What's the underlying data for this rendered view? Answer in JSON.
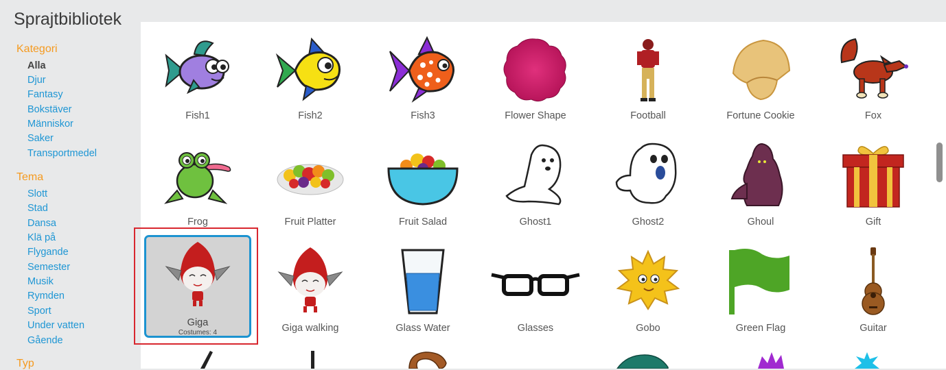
{
  "title": "Sprajtbibliotek",
  "sidebar": {
    "category_heading": "Kategori",
    "categories": [
      "Alla",
      "Djur",
      "Fantasy",
      "Bokstäver",
      "Människor",
      "Saker",
      "Transportmedel"
    ],
    "theme_heading": "Tema",
    "themes": [
      "Slott",
      "Stad",
      "Dansa",
      "Klä på",
      "Flygande",
      "Semester",
      "Musik",
      "Rymden",
      "Sport",
      "Under vatten",
      "Gående"
    ],
    "type_heading": "Typ"
  },
  "sprites": [
    {
      "name": "Fish1",
      "icon": "fish1-icon"
    },
    {
      "name": "Fish2",
      "icon": "fish2-icon"
    },
    {
      "name": "Fish3",
      "icon": "fish3-icon"
    },
    {
      "name": "Flower Shape",
      "icon": "flower-shape-icon"
    },
    {
      "name": "Football",
      "icon": "football-player-icon"
    },
    {
      "name": "Fortune Cookie",
      "icon": "fortune-cookie-icon"
    },
    {
      "name": "Fox",
      "icon": "fox-icon"
    },
    {
      "name": "Frog",
      "icon": "frog-icon"
    },
    {
      "name": "Fruit Platter",
      "icon": "fruit-platter-icon"
    },
    {
      "name": "Fruit Salad",
      "icon": "fruit-salad-icon"
    },
    {
      "name": "Ghost1",
      "icon": "ghost1-icon"
    },
    {
      "name": "Ghost2",
      "icon": "ghost2-icon"
    },
    {
      "name": "Ghoul",
      "icon": "ghoul-icon"
    },
    {
      "name": "Gift",
      "icon": "gift-icon"
    },
    {
      "name": "Giga",
      "icon": "giga-icon",
      "selected": true,
      "costumes": "Costumes: 4"
    },
    {
      "name": "Giga walking",
      "icon": "giga-walking-icon"
    },
    {
      "name": "Glass Water",
      "icon": "glass-water-icon"
    },
    {
      "name": "Glasses",
      "icon": "glasses-icon"
    },
    {
      "name": "Gobo",
      "icon": "gobo-icon"
    },
    {
      "name": "Green Flag",
      "icon": "green-flag-icon"
    },
    {
      "name": "Guitar",
      "icon": "guitar-icon"
    }
  ],
  "colors": {
    "heading": "#f59a1f",
    "link": "#1e96d4",
    "selection_border": "#1c93d0",
    "highlight_box": "#d8262e"
  }
}
